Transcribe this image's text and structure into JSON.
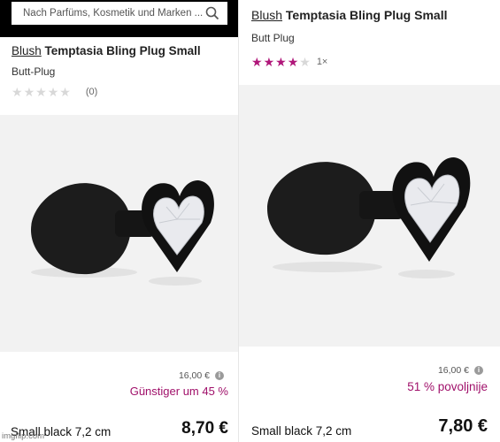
{
  "left": {
    "search": {
      "placeholder": "Nach Parfüms, Kosmetik und Marken ..."
    },
    "brand": "Blush",
    "product_name": "Temptasia Bling Plug Small",
    "category": "Butt-Plug",
    "rating": {
      "stars": 0,
      "max": 5,
      "count_text": "(0)"
    },
    "old_price": "16,00 €",
    "discount": "Günstiger um 45 %",
    "variant": "Small black 7,2 cm",
    "price": "8,70 €"
  },
  "right": {
    "brand": "Blush",
    "product_name": "Temptasia Bling Plug Small",
    "category": "Butt Plug",
    "rating": {
      "stars": 4,
      "max": 5,
      "count_text": "1×"
    },
    "old_price": "16,00 €",
    "discount": "51 % povoljnije",
    "variant": "Small black 7,2 cm",
    "price": "7,80 €"
  },
  "watermark": "imgflip.com",
  "icons": {
    "search": "search-icon",
    "info": "info-icon",
    "star": "star-icon"
  },
  "colors": {
    "accent": "#a0106a",
    "star_active": "#b0177a",
    "star_inactive": "#d8d8d8",
    "header": "#000000"
  }
}
